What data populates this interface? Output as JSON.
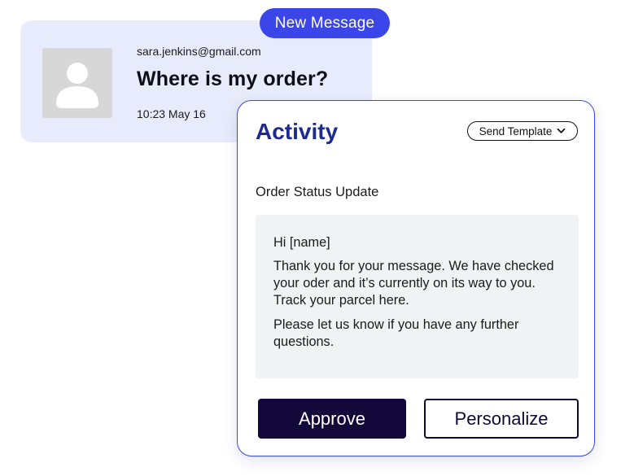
{
  "message": {
    "badge": "New Message",
    "sender": "sara.jenkins@gmail.com",
    "subject": "Where is my order?",
    "timestamp": "10:23 May 16",
    "avatar_icon": "user-placeholder-icon"
  },
  "activity": {
    "title": "Activity",
    "template_button": "Send Template",
    "template_button_icon": "chevron-down-icon",
    "section_label": "Order Status Update",
    "template": {
      "greeting": "Hi [name]",
      "paragraph_1": "Thank you for your message. We have checked your oder and it’s currently on its way to you. Track your parcel here.",
      "paragraph_2": "Please let us know if you have any further questions."
    },
    "approve_label": "Approve",
    "personalize_label": "Personalize"
  },
  "colors": {
    "accent": "#3b46e8",
    "title": "#1d2a8f",
    "primary_button": "#12083a",
    "card_background": "#e8ebfb",
    "template_background": "#f1f2f3"
  }
}
